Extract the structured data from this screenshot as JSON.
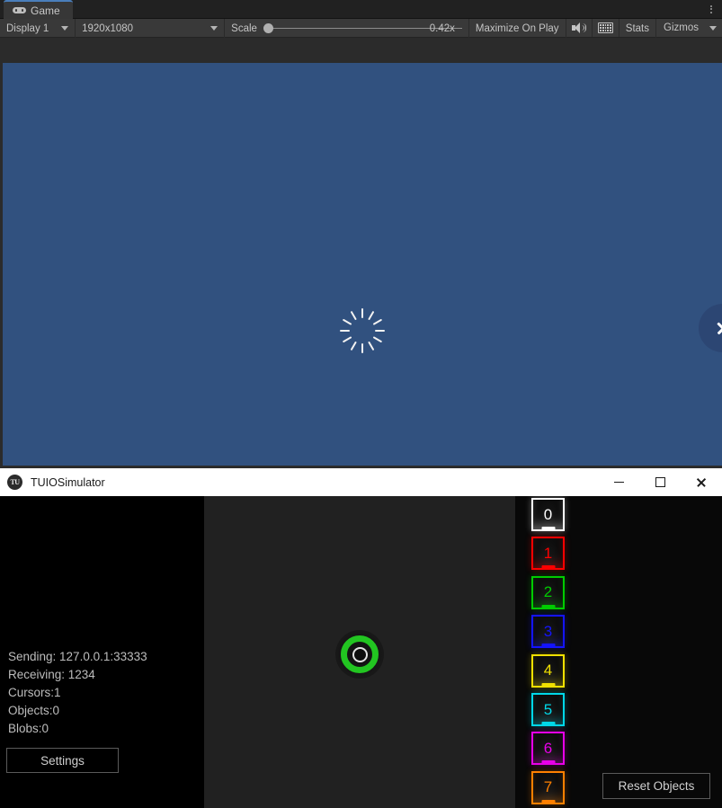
{
  "unity": {
    "tab": {
      "label": "Game",
      "icon": "gamepad-icon",
      "menu_icon": "kebab-menu-icon"
    },
    "toolbar": {
      "display": "Display 1",
      "resolution": "1920x1080",
      "scale_label": "Scale",
      "scale_value": "0.42x",
      "maximize_on_play": "Maximize On Play",
      "mute_audio_icon": "speaker-icon",
      "stats_grid_icon": "keyboard-grid-icon",
      "stats": "Stats",
      "gizmos": "Gizmos"
    },
    "game_view": {
      "background_color": "#31517f",
      "spinner": {
        "name": "loading-spinner",
        "spokes": 12,
        "color": "#f2f2f2"
      },
      "close_overlay": {
        "name": "close-overlay-button",
        "glyph": "×",
        "color": "#2c4673"
      }
    }
  },
  "tuio": {
    "window": {
      "title": "TUIOSimulator",
      "app_icon_text": "TU",
      "minimize": "—",
      "maximize": "□",
      "close": "✕"
    },
    "status": [
      "Sending: 127.0.0.1:33333",
      "Receiving: 1234",
      "Cursors:1",
      "Objects:0",
      "Blobs:0"
    ],
    "settings_button": "Settings",
    "reset_objects_button": "Reset Objects",
    "cursor": {
      "name": "tuio-cursor",
      "ring_color": "#22c521",
      "core_color": "#e2e2e2"
    },
    "object_palette": [
      {
        "label": "0",
        "color": "#ffffff"
      },
      {
        "label": "1",
        "color": "#ff0000"
      },
      {
        "label": "2",
        "color": "#00cc00"
      },
      {
        "label": "3",
        "color": "#1414ff"
      },
      {
        "label": "4",
        "color": "#f0e000"
      },
      {
        "label": "5",
        "color": "#00d8e8"
      },
      {
        "label": "6",
        "color": "#e800e8"
      },
      {
        "label": "7",
        "color": "#ff8000"
      }
    ]
  }
}
